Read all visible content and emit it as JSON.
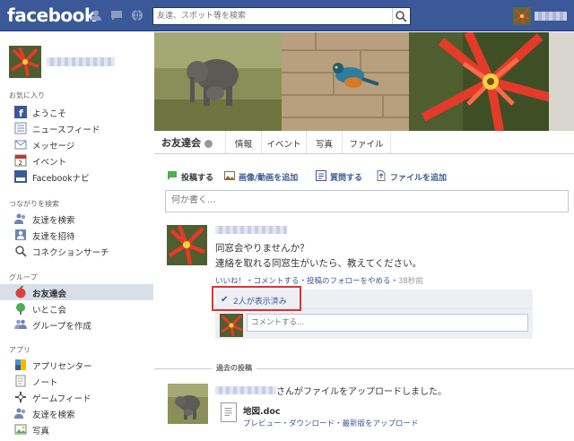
{
  "header": {
    "logo": "facebook",
    "search_placeholder": "友達、スポット等を検索"
  },
  "sidebar": {
    "favorites_title": "お気に入り",
    "favorites": [
      {
        "label": "ようこそ",
        "icon": "facebook-icon"
      },
      {
        "label": "ニュースフィード",
        "icon": "news-feed-icon"
      },
      {
        "label": "メッセージ",
        "icon": "message-icon"
      },
      {
        "label": "イベント",
        "icon": "calendar-icon"
      },
      {
        "label": "Facebookナビ",
        "icon": "navi-icon"
      }
    ],
    "connect_title": "つながりを検索",
    "connect": [
      {
        "label": "友達を検索",
        "icon": "find-friends-icon"
      },
      {
        "label": "友達を招待",
        "icon": "invite-icon"
      },
      {
        "label": "コネクションサーチ",
        "icon": "search-icon"
      }
    ],
    "groups_title": "グループ",
    "groups": [
      {
        "label": "お友達会",
        "icon": "apple-icon",
        "active": true
      },
      {
        "label": "いとこ会",
        "icon": "tree-icon"
      },
      {
        "label": "グループを作成",
        "icon": "create-group-icon"
      }
    ],
    "apps_title": "アプリ",
    "apps": [
      {
        "label": "アプリセンター",
        "icon": "app-center-icon"
      },
      {
        "label": "ノート",
        "icon": "note-icon"
      },
      {
        "label": "ゲームフィード",
        "icon": "game-icon"
      },
      {
        "label": "友達を検索",
        "icon": "find-friends-icon"
      },
      {
        "label": "写真",
        "icon": "photo-icon"
      }
    ]
  },
  "tabs": {
    "group_name": "お友達会",
    "items": [
      "情報",
      "イベント",
      "写真",
      "ファイル"
    ]
  },
  "composer": {
    "actions": [
      "投稿する",
      "画像/動画を追加",
      "質問する",
      "ファイルを追加"
    ],
    "placeholder": "何か書く..."
  },
  "post": {
    "line1": "同窓会やりませんか？",
    "line2": "連絡を取れる同窓生がいたら、教えてください。",
    "actions": "いいね！・コメントする・投稿のフォローをやめる・",
    "time": "38秒前",
    "seen": "2人が表示済み",
    "comment_placeholder": "コメントする..."
  },
  "past": {
    "label": "過去の投稿",
    "text": "さんがファイルをアップロードしました。",
    "file_name": "地図.doc",
    "file_links": "プレビュー・ダウンロード・最新版をアップロード"
  },
  "colors": {
    "brand": "#3b5998",
    "highlight": "#e23030",
    "active_nav": "#d8dfea"
  }
}
